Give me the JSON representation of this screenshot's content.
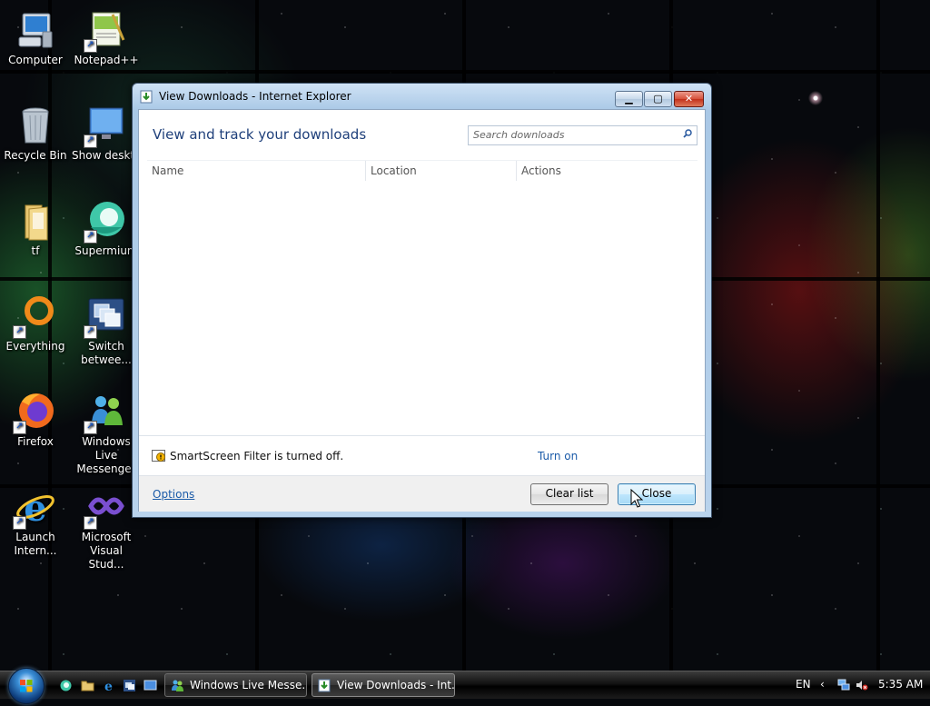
{
  "desktop": {
    "icons": [
      {
        "label": "Computer",
        "icon": "computer-icon"
      },
      {
        "label": "Notepad++",
        "icon": "notepad-plus-plus-icon"
      },
      {
        "label": "Recycle Bin",
        "icon": "recycle-bin-icon"
      },
      {
        "label": "Show deskto",
        "icon": "show-desktop-icon"
      },
      {
        "label": "tf",
        "icon": "folder-icon"
      },
      {
        "label": "Supermium",
        "icon": "supermium-icon"
      },
      {
        "label": "Everything",
        "icon": "everything-search-icon"
      },
      {
        "label": "Switch betwee...",
        "icon": "switch-windows-icon"
      },
      {
        "label": "Firefox",
        "icon": "firefox-icon"
      },
      {
        "label": "Windows Live Messenger",
        "icon": "windows-live-messenger-icon"
      },
      {
        "label": "Launch Intern...",
        "icon": "internet-explorer-icon"
      },
      {
        "label": "Microsoft Visual Stud...",
        "icon": "visual-studio-icon"
      }
    ]
  },
  "dialog": {
    "window_title": "View Downloads - Internet Explorer",
    "header": "View and track your downloads",
    "search_placeholder": "Search downloads",
    "columns": [
      "Name",
      "Location",
      "Actions"
    ],
    "smartscreen_text": "SmartScreen Filter is turned off.",
    "turn_on_link": "Turn on",
    "options_link": "Options",
    "clear_list_button": "Clear list",
    "close_button": "Close"
  },
  "taskbar": {
    "tasks": [
      {
        "label": "Windows Live Messe...",
        "icon": "windows-live-messenger-icon"
      },
      {
        "label": "View Downloads - Int...",
        "icon": "internet-explorer-icon"
      }
    ],
    "language": "EN",
    "clock": "5:35 AM"
  },
  "colors": {
    "dialog_header": "#1e3f7a",
    "link": "#1a5aa8",
    "close_button_red": "#c2301b"
  }
}
